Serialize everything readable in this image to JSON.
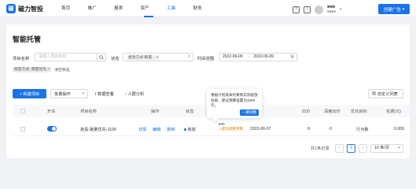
{
  "app": {
    "logo_mark": "磁",
    "name": "磁力智投"
  },
  "nav": {
    "items": [
      {
        "label": "首页"
      },
      {
        "label": "推广"
      },
      {
        "label": "报表"
      },
      {
        "label": "资产"
      },
      {
        "label": "工具"
      },
      {
        "label": "财务"
      }
    ],
    "active_index": 4
  },
  "header": {
    "user_name": "■■■",
    "user_sub": "■■■■",
    "create_ad_label": "创建广告"
  },
  "page": {
    "title": "智能托管"
  },
  "filters": {
    "project_name_label": "项目名称",
    "project_name_placeholder": "请输入项目名称",
    "status_label": "状态",
    "status_value": "投放方式:跑量...",
    "time_range_label": "时间范围",
    "date_start": "2022-06-09",
    "date_sep": "→",
    "date_end": "2022-06-09",
    "active_tag": "投放方式: 跑量优先",
    "clear_label": "清空筛选"
  },
  "toolbar": {
    "new_project_label": "+ 新建项目",
    "batch_label": "批量操作",
    "data_view_label": "数据查看",
    "people_analysis_label": "人群分析",
    "custom_columns_label": "自定义列表"
  },
  "table": {
    "headers": [
      "开关",
      "项目名称",
      "操作",
      "状态",
      "",
      "",
      "出价",
      "深度出价",
      "优化目标",
      "花费(元)"
    ],
    "rows": [
      {
        "name": "批投-跑量优先-1100",
        "actions": [
          "详情",
          "编辑",
          "复制"
        ],
        "status": "有效",
        "budget": "500",
        "budget_note": "建议调整预算",
        "date": "2022-06-07",
        "bid": "9",
        "deep_bid": "0",
        "goal": "行为数",
        "spend": "0.000"
      }
    ]
  },
  "pagination": {
    "total": "共1条记录",
    "prev": "<",
    "current": "1",
    "next": ">",
    "page_size": "10 条/页"
  },
  "popover": {
    "text": "根据计划成本约束和实际投放效果，建议预算设置为1000元。",
    "button": "一键调整"
  },
  "colors": {
    "primary": "#1a73e8",
    "warning": "#d48806"
  }
}
